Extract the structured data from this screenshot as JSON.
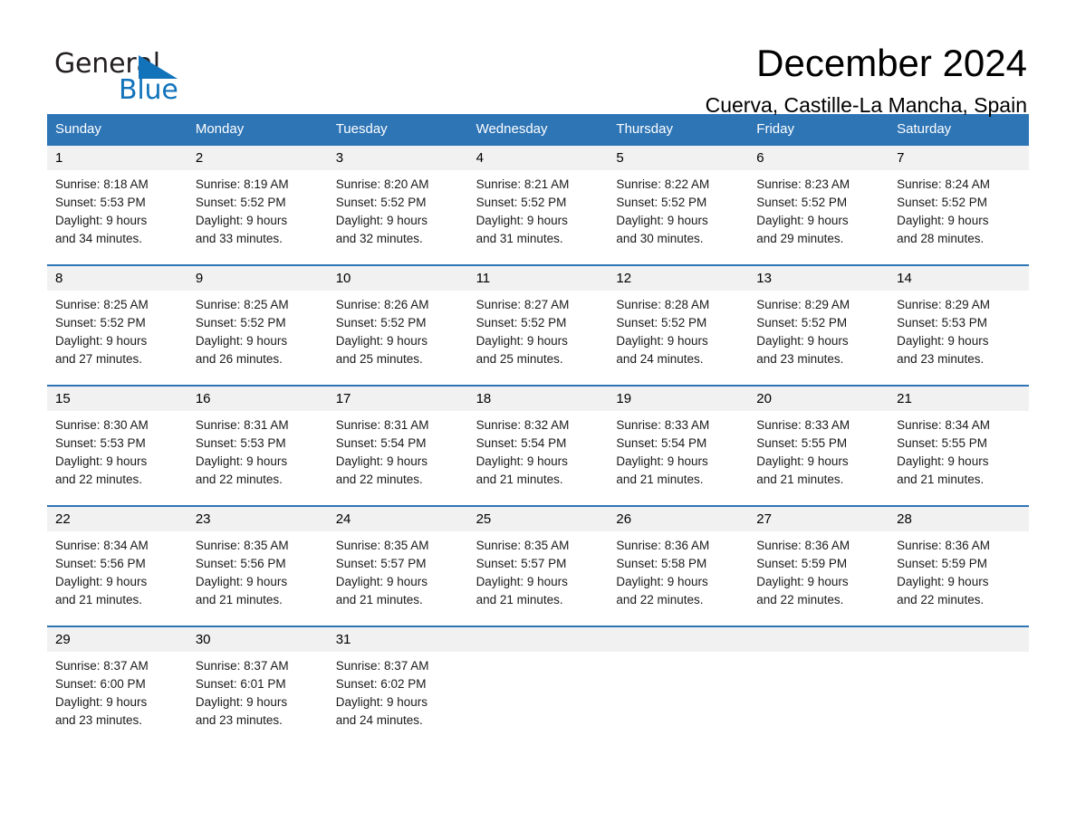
{
  "brand": {
    "word_one": "General",
    "word_two": "Blue",
    "triangle_color": "#1273bb",
    "text_color": "#231f20"
  },
  "header": {
    "month_title": "December 2024",
    "location": "Cuerva, Castille-La Mancha, Spain",
    "header_bar_color": "#2e75b6",
    "daynum_band_color": "#f1f1f1"
  },
  "weekdays": [
    "Sunday",
    "Monday",
    "Tuesday",
    "Wednesday",
    "Thursday",
    "Friday",
    "Saturday"
  ],
  "weeks": [
    {
      "days": [
        {
          "num": "1",
          "sunrise": "Sunrise: 8:18 AM",
          "sunset": "Sunset: 5:53 PM",
          "daylight_1": "Daylight: 9 hours",
          "daylight_2": "and 34 minutes."
        },
        {
          "num": "2",
          "sunrise": "Sunrise: 8:19 AM",
          "sunset": "Sunset: 5:52 PM",
          "daylight_1": "Daylight: 9 hours",
          "daylight_2": "and 33 minutes."
        },
        {
          "num": "3",
          "sunrise": "Sunrise: 8:20 AM",
          "sunset": "Sunset: 5:52 PM",
          "daylight_1": "Daylight: 9 hours",
          "daylight_2": "and 32 minutes."
        },
        {
          "num": "4",
          "sunrise": "Sunrise: 8:21 AM",
          "sunset": "Sunset: 5:52 PM",
          "daylight_1": "Daylight: 9 hours",
          "daylight_2": "and 31 minutes."
        },
        {
          "num": "5",
          "sunrise": "Sunrise: 8:22 AM",
          "sunset": "Sunset: 5:52 PM",
          "daylight_1": "Daylight: 9 hours",
          "daylight_2": "and 30 minutes."
        },
        {
          "num": "6",
          "sunrise": "Sunrise: 8:23 AM",
          "sunset": "Sunset: 5:52 PM",
          "daylight_1": "Daylight: 9 hours",
          "daylight_2": "and 29 minutes."
        },
        {
          "num": "7",
          "sunrise": "Sunrise: 8:24 AM",
          "sunset": "Sunset: 5:52 PM",
          "daylight_1": "Daylight: 9 hours",
          "daylight_2": "and 28 minutes."
        }
      ]
    },
    {
      "days": [
        {
          "num": "8",
          "sunrise": "Sunrise: 8:25 AM",
          "sunset": "Sunset: 5:52 PM",
          "daylight_1": "Daylight: 9 hours",
          "daylight_2": "and 27 minutes."
        },
        {
          "num": "9",
          "sunrise": "Sunrise: 8:25 AM",
          "sunset": "Sunset: 5:52 PM",
          "daylight_1": "Daylight: 9 hours",
          "daylight_2": "and 26 minutes."
        },
        {
          "num": "10",
          "sunrise": "Sunrise: 8:26 AM",
          "sunset": "Sunset: 5:52 PM",
          "daylight_1": "Daylight: 9 hours",
          "daylight_2": "and 25 minutes."
        },
        {
          "num": "11",
          "sunrise": "Sunrise: 8:27 AM",
          "sunset": "Sunset: 5:52 PM",
          "daylight_1": "Daylight: 9 hours",
          "daylight_2": "and 25 minutes."
        },
        {
          "num": "12",
          "sunrise": "Sunrise: 8:28 AM",
          "sunset": "Sunset: 5:52 PM",
          "daylight_1": "Daylight: 9 hours",
          "daylight_2": "and 24 minutes."
        },
        {
          "num": "13",
          "sunrise": "Sunrise: 8:29 AM",
          "sunset": "Sunset: 5:52 PM",
          "daylight_1": "Daylight: 9 hours",
          "daylight_2": "and 23 minutes."
        },
        {
          "num": "14",
          "sunrise": "Sunrise: 8:29 AM",
          "sunset": "Sunset: 5:53 PM",
          "daylight_1": "Daylight: 9 hours",
          "daylight_2": "and 23 minutes."
        }
      ]
    },
    {
      "days": [
        {
          "num": "15",
          "sunrise": "Sunrise: 8:30 AM",
          "sunset": "Sunset: 5:53 PM",
          "daylight_1": "Daylight: 9 hours",
          "daylight_2": "and 22 minutes."
        },
        {
          "num": "16",
          "sunrise": "Sunrise: 8:31 AM",
          "sunset": "Sunset: 5:53 PM",
          "daylight_1": "Daylight: 9 hours",
          "daylight_2": "and 22 minutes."
        },
        {
          "num": "17",
          "sunrise": "Sunrise: 8:31 AM",
          "sunset": "Sunset: 5:54 PM",
          "daylight_1": "Daylight: 9 hours",
          "daylight_2": "and 22 minutes."
        },
        {
          "num": "18",
          "sunrise": "Sunrise: 8:32 AM",
          "sunset": "Sunset: 5:54 PM",
          "daylight_1": "Daylight: 9 hours",
          "daylight_2": "and 21 minutes."
        },
        {
          "num": "19",
          "sunrise": "Sunrise: 8:33 AM",
          "sunset": "Sunset: 5:54 PM",
          "daylight_1": "Daylight: 9 hours",
          "daylight_2": "and 21 minutes."
        },
        {
          "num": "20",
          "sunrise": "Sunrise: 8:33 AM",
          "sunset": "Sunset: 5:55 PM",
          "daylight_1": "Daylight: 9 hours",
          "daylight_2": "and 21 minutes."
        },
        {
          "num": "21",
          "sunrise": "Sunrise: 8:34 AM",
          "sunset": "Sunset: 5:55 PM",
          "daylight_1": "Daylight: 9 hours",
          "daylight_2": "and 21 minutes."
        }
      ]
    },
    {
      "days": [
        {
          "num": "22",
          "sunrise": "Sunrise: 8:34 AM",
          "sunset": "Sunset: 5:56 PM",
          "daylight_1": "Daylight: 9 hours",
          "daylight_2": "and 21 minutes."
        },
        {
          "num": "23",
          "sunrise": "Sunrise: 8:35 AM",
          "sunset": "Sunset: 5:56 PM",
          "daylight_1": "Daylight: 9 hours",
          "daylight_2": "and 21 minutes."
        },
        {
          "num": "24",
          "sunrise": "Sunrise: 8:35 AM",
          "sunset": "Sunset: 5:57 PM",
          "daylight_1": "Daylight: 9 hours",
          "daylight_2": "and 21 minutes."
        },
        {
          "num": "25",
          "sunrise": "Sunrise: 8:35 AM",
          "sunset": "Sunset: 5:57 PM",
          "daylight_1": "Daylight: 9 hours",
          "daylight_2": "and 21 minutes."
        },
        {
          "num": "26",
          "sunrise": "Sunrise: 8:36 AM",
          "sunset": "Sunset: 5:58 PM",
          "daylight_1": "Daylight: 9 hours",
          "daylight_2": "and 22 minutes."
        },
        {
          "num": "27",
          "sunrise": "Sunrise: 8:36 AM",
          "sunset": "Sunset: 5:59 PM",
          "daylight_1": "Daylight: 9 hours",
          "daylight_2": "and 22 minutes."
        },
        {
          "num": "28",
          "sunrise": "Sunrise: 8:36 AM",
          "sunset": "Sunset: 5:59 PM",
          "daylight_1": "Daylight: 9 hours",
          "daylight_2": "and 22 minutes."
        }
      ]
    },
    {
      "days": [
        {
          "num": "29",
          "sunrise": "Sunrise: 8:37 AM",
          "sunset": "Sunset: 6:00 PM",
          "daylight_1": "Daylight: 9 hours",
          "daylight_2": "and 23 minutes."
        },
        {
          "num": "30",
          "sunrise": "Sunrise: 8:37 AM",
          "sunset": "Sunset: 6:01 PM",
          "daylight_1": "Daylight: 9 hours",
          "daylight_2": "and 23 minutes."
        },
        {
          "num": "31",
          "sunrise": "Sunrise: 8:37 AM",
          "sunset": "Sunset: 6:02 PM",
          "daylight_1": "Daylight: 9 hours",
          "daylight_2": "and 24 minutes."
        },
        {
          "num": "",
          "sunrise": "",
          "sunset": "",
          "daylight_1": "",
          "daylight_2": ""
        },
        {
          "num": "",
          "sunrise": "",
          "sunset": "",
          "daylight_1": "",
          "daylight_2": ""
        },
        {
          "num": "",
          "sunrise": "",
          "sunset": "",
          "daylight_1": "",
          "daylight_2": ""
        },
        {
          "num": "",
          "sunrise": "",
          "sunset": "",
          "daylight_1": "",
          "daylight_2": ""
        }
      ]
    }
  ]
}
